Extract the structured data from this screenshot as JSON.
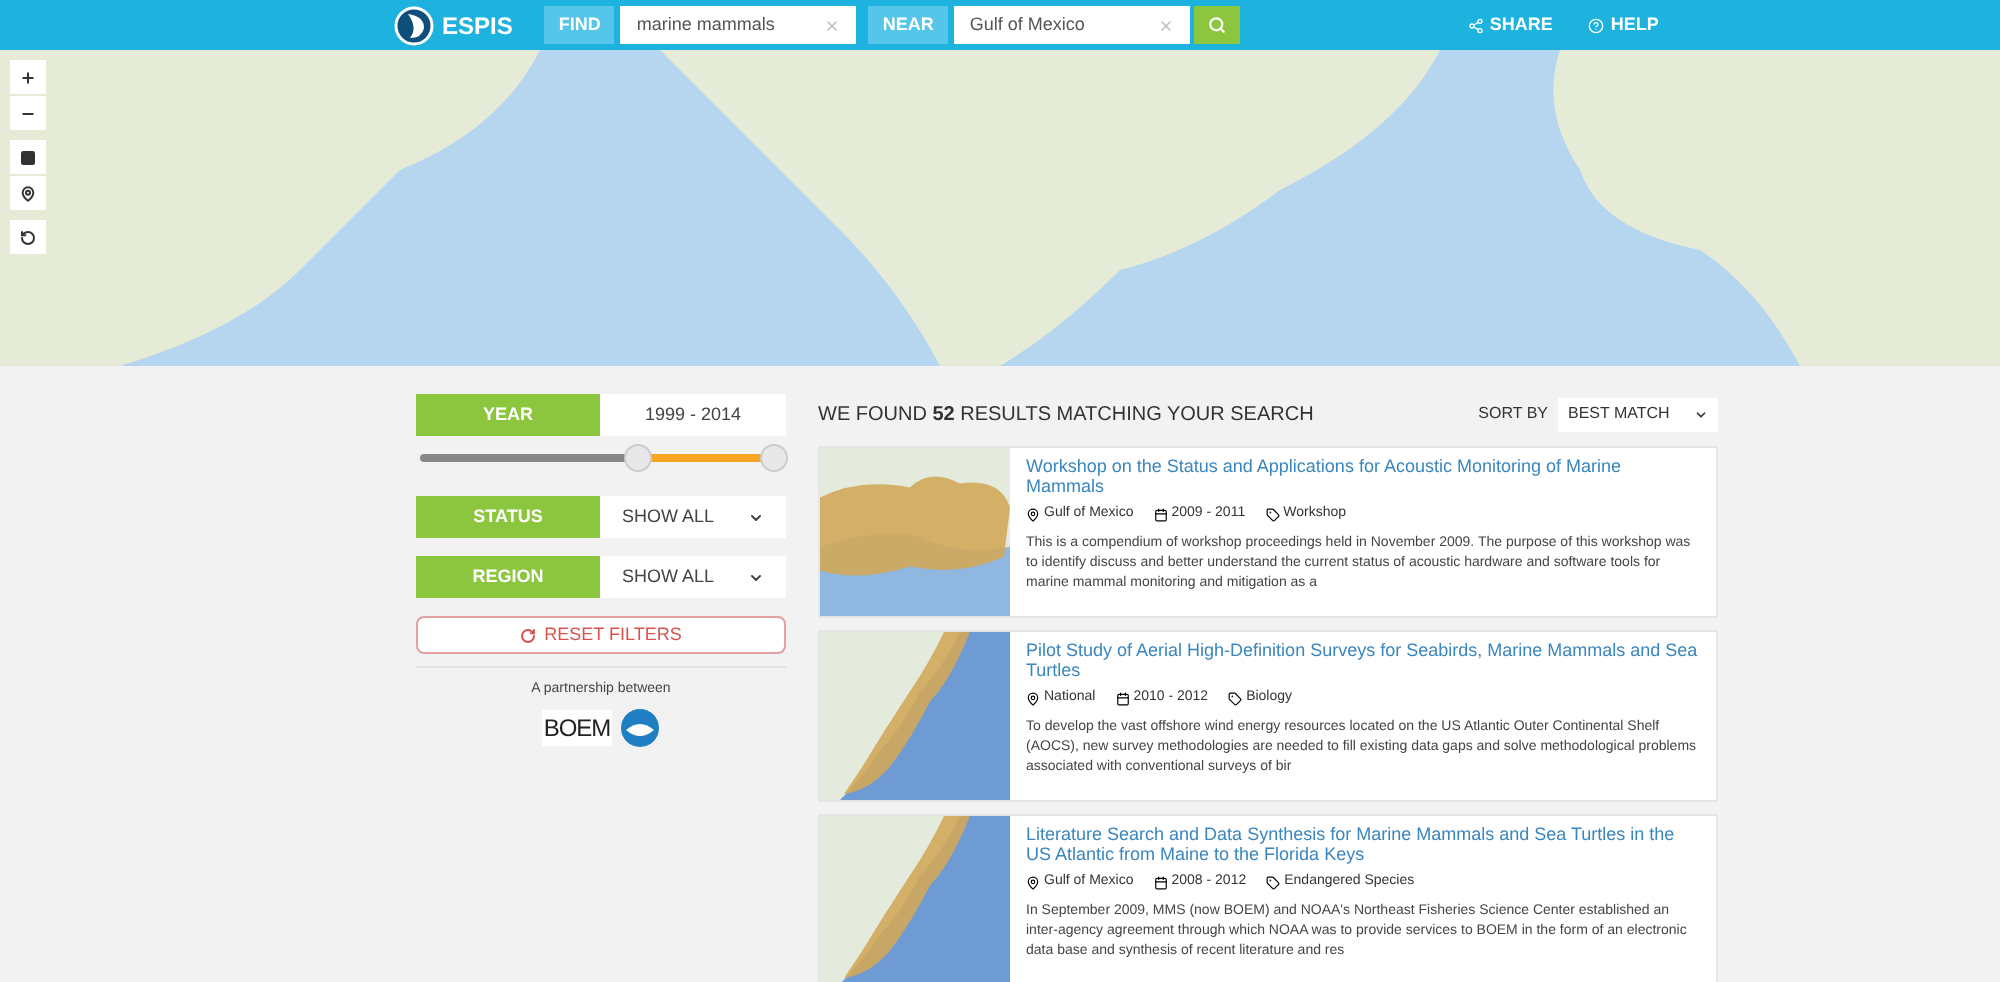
{
  "header": {
    "brand": "ESPIS",
    "find": {
      "label": "FIND",
      "value": "marine mammals"
    },
    "near": {
      "label": "NEAR",
      "value": "Gulf of Mexico"
    },
    "links": [
      {
        "kind": "share",
        "label": "SHARE"
      },
      {
        "kind": "help",
        "label": "HELP"
      }
    ]
  },
  "map_controls": [
    {
      "kind": "zoom-in"
    },
    {
      "kind": "zoom-out"
    },
    {
      "kind": "square"
    },
    {
      "kind": "pin"
    },
    {
      "kind": "reset"
    }
  ],
  "filters": {
    "year": {
      "label": "YEAR",
      "value": "1999 - 2014"
    },
    "slider": {
      "thumbs": [
        {
          "level": 0.6
        },
        {
          "level": 0.98
        }
      ]
    },
    "selects": [
      {
        "label": "STATUS",
        "value": "SHOW ALL"
      },
      {
        "label": "REGION",
        "value": "SHOW ALL"
      }
    ],
    "reset": "RESET FILTERS",
    "partnership": "A partnership between",
    "partner_logo": "BOEM"
  },
  "results": {
    "summary": "WE FOUND **52** RESULTS MATCHING YOUR SEARCH",
    "sort_label": "SORT BY",
    "sort_value": "BEST MATCH",
    "items": [
      {
        "kind": "gulf",
        "title": "Workshop on the Status and Applications for Acoustic Monitoring of Marine Mammals",
        "location": "Gulf of Mexico",
        "years": "2009 - 2011",
        "tag": "Workshop",
        "description": "This is a compendium of workshop proceedings held in November 2009. The purpose of this workshop was to identify discuss and better understand the current status of acoustic hardware and software tools for marine mammal monitoring and mitigation as a"
      },
      {
        "kind": "atlantic",
        "title": "Pilot Study of Aerial High-Definition Surveys for Seabirds, Marine Mammals and Sea Turtles",
        "location": "National",
        "years": "2010 - 2012",
        "tag": "Biology",
        "description": "To develop the vast offshore wind energy resources located on the US Atlantic Outer Continental Shelf (AOCS), new survey methodologies are needed to fill existing data gaps and solve methodological problems associated with conventional surveys of bir"
      },
      {
        "kind": "atlantic",
        "title": "Literature Search and Data Synthesis for Marine Mammals and Sea Turtles in the US Atlantic from Maine to the Florida Keys",
        "location": "Gulf of Mexico",
        "years": "2008 - 2012",
        "tag": "Endangered Species",
        "description": "In September 2009, MMS (now BOEM) and NOAA's Northeast Fisheries Science Center established an inter-agency agreement through which NOAA was to provide services to BOEM in the form of an electronic data base and synthesis of recent literature and res"
      }
    ]
  }
}
